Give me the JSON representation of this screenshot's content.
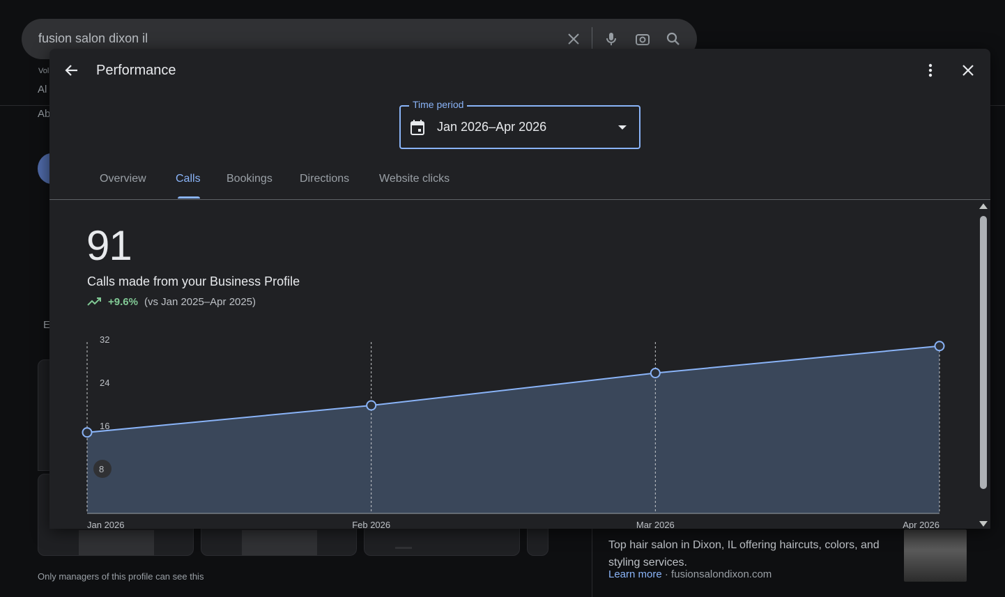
{
  "background": {
    "search_query": "fusion salon dixon il",
    "fragments": [
      "Vol",
      "Al",
      "Ab",
      "E"
    ],
    "result_description": "Top hair salon in Dixon, IL offering haircuts, colors, and styling services.",
    "learn_more": "Learn more",
    "domain": "· fusionsalondixon.com",
    "managers_note": "Only managers of this profile can see this"
  },
  "modal": {
    "title": "Performance",
    "time_period_label": "Time period",
    "time_period_value": "Jan 2026–Apr 2026",
    "tabs": [
      "Overview",
      "Calls",
      "Bookings",
      "Directions",
      "Website clicks"
    ],
    "active_tab": "Calls",
    "metric": {
      "value": "91",
      "label": "Calls made from your Business Profile",
      "change": "+9.6%",
      "comparison": "(vs Jan 2025–Apr 2025)"
    }
  },
  "colors": {
    "accent": "#8ab4f8",
    "positive": "#81c995",
    "area_fill": "#3c4a5e"
  },
  "chart_data": {
    "type": "area",
    "x": [
      "Jan 2026",
      "Feb 2026",
      "Mar 2026",
      "Apr 2026"
    ],
    "series": [
      {
        "values": [
          15,
          20,
          26,
          31
        ]
      }
    ],
    "ylim": [
      0,
      32
    ],
    "yticks": [
      8,
      16,
      24,
      32
    ],
    "grid": "vertical dashed lines at each x",
    "markers": "open circles"
  }
}
